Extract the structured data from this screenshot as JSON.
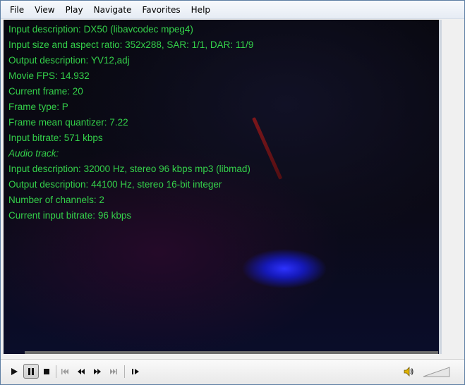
{
  "menubar": {
    "items": [
      "File",
      "View",
      "Play",
      "Navigate",
      "Favorites",
      "Help"
    ]
  },
  "info_overlay": {
    "lines": [
      "Input description: DX50 (libavcodec mpeg4)",
      "Input size and aspect ratio: 352x288, SAR: 1/1, DAR: 11/9",
      "Output description: YV12,adj",
      "Movie FPS: 14.932",
      "Current frame: 20",
      "Frame type: P",
      "Frame mean quantizer: 7.22",
      "Input bitrate: 571 kbps",
      "Audio track:",
      "Input description: 32000 Hz, stereo 96 kbps mp3 (libmad)",
      "Output description: 44100 Hz, stereo 16-bit integer",
      "Number of channels: 2",
      "Current input bitrate: 96 kbps"
    ]
  },
  "colors": {
    "overlay_text": "#34d14a",
    "video_background": "#08080f"
  },
  "controls": {
    "icons": [
      "play-icon",
      "pause-icon",
      "stop-icon",
      "skip-previous-icon",
      "rewind-icon",
      "fast-forward-icon",
      "skip-next-icon",
      "frame-step-icon",
      "speaker-icon"
    ],
    "pause_pressed": true
  }
}
